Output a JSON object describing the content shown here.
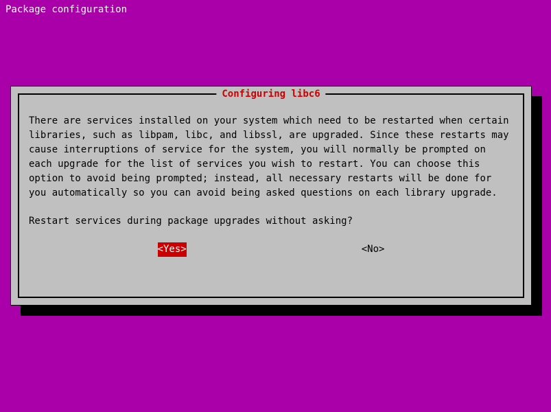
{
  "header": {
    "title": "Package configuration"
  },
  "dialog": {
    "title": " Configuring libc6 ",
    "body": "There are services installed on your system which need to be restarted when certain libraries, such as libpam, libc, and libssl, are upgraded. Since these restarts may cause interruptions of service for the system, you will normally be prompted on each upgrade for the list of services you wish to restart.  You can choose this option to avoid being prompted; instead, all necessary restarts will be done for you automatically so you can avoid being asked questions on each library upgrade.",
    "question": "Restart services during package upgrades without asking?",
    "buttons": {
      "yes": "<Yes>",
      "no": "<No>"
    }
  }
}
